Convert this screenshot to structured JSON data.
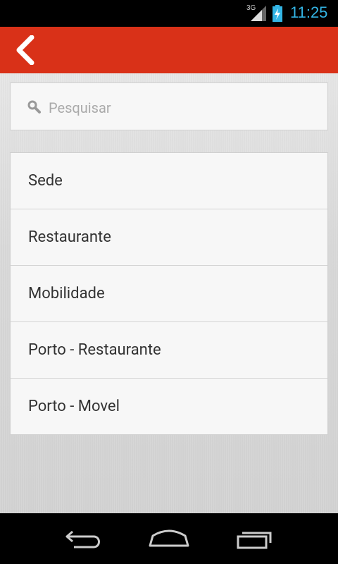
{
  "status_bar": {
    "network": "3G",
    "time": "11:25"
  },
  "action_bar": {
    "back_icon": "chevron-left-icon"
  },
  "search": {
    "placeholder": "Pesquisar",
    "value": ""
  },
  "list": {
    "items": [
      {
        "label": "Sede"
      },
      {
        "label": "Restaurante"
      },
      {
        "label": "Mobilidade"
      },
      {
        "label": "Porto - Restaurante"
      },
      {
        "label": "Porto - Movel"
      }
    ]
  },
  "nav_bar": {
    "back_icon": "back-arrow-icon",
    "home_icon": "home-icon",
    "recent_icon": "recent-apps-icon"
  },
  "colors": {
    "action_bar": "#d93118",
    "status_accent": "#33b5e5"
  }
}
